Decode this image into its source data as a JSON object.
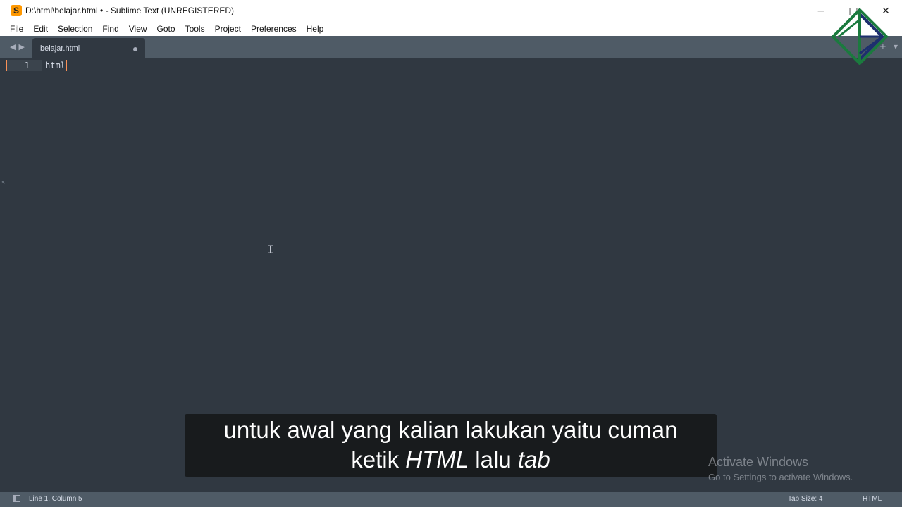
{
  "window": {
    "title": "D:\\html\\belajar.html • - Sublime Text (UNREGISTERED)",
    "app_icon_glyph": "S",
    "controls": [
      "−",
      "□",
      "✕"
    ]
  },
  "menu": [
    "File",
    "Edit",
    "Selection",
    "Find",
    "View",
    "Goto",
    "Tools",
    "Project",
    "Preferences",
    "Help"
  ],
  "tabs": [
    {
      "label": "belajar.html",
      "dirty": true,
      "active": true
    }
  ],
  "tabbar_icons": [
    "+",
    "▾"
  ],
  "editor": {
    "lines": [
      {
        "number": "1",
        "text": "html"
      }
    ],
    "mouse_cursor_icon": "ibeam-cursor-icon"
  },
  "subtitle": {
    "line1": "untuk awal yang kalian lakukan yaitu cuman",
    "line2_a": "ketik ",
    "line2_b": "HTML",
    "line2_c": " lalu ",
    "line2_d": "tab"
  },
  "watermark": {
    "title": "Activate Windows",
    "subtitle": "Go to Settings to activate Windows."
  },
  "statusbar": {
    "position": "Line 1, Column 5",
    "tab_size": "Tab Size: 4",
    "syntax": "HTML"
  },
  "colors": {
    "editor_bg": "#303841",
    "chrome_bg": "#4f5b66",
    "text": "#d8dee9",
    "caret": "#f99157",
    "logo_green": "#1b7a3e",
    "logo_navy": "#1d2f6e"
  }
}
